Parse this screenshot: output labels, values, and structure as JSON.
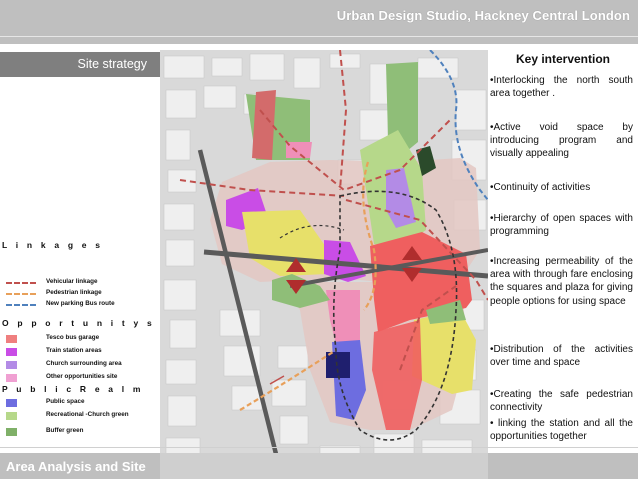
{
  "header": {
    "title": "Urban Design Studio, Hackney Central London"
  },
  "left": {
    "section_title": "Site strategy"
  },
  "legend": {
    "linkages_head": "L i n k a g e s",
    "linkages": [
      {
        "label": "Vehicular linkage",
        "color": "#c0504d"
      },
      {
        "label": "Pedestrian linkage",
        "color": "#e8a05a"
      },
      {
        "label": "New parking Bus route",
        "color": "#4f81bd"
      }
    ],
    "opportunity_head": "O p p o r t u n i t y s i t e s",
    "opportunity": [
      {
        "label": "Tesco bus garage",
        "color": "#ef7f7f"
      },
      {
        "label": "Train station areas",
        "color": "#c94de6"
      },
      {
        "label": "Church surrounding area",
        "color": "#b38be6"
      },
      {
        "label": "Other opportunities site",
        "color": "#f0a0d2"
      }
    ],
    "public_head": "P u b l i c R e a l m",
    "public": [
      {
        "label": "Public space",
        "color": "#6d6de0"
      },
      {
        "label": "Recreational -Church green",
        "color": "#b6d88a"
      },
      {
        "label": "Buffer green",
        "color": "#7fb068"
      }
    ]
  },
  "key": {
    "title": "Key intervention",
    "bullets": [
      "•Interlocking the north south area together .",
      "•Active void space by introducing program and visually appealing",
      "•Continuity of activities",
      "•Hierarchy of open spaces with programming",
      "•Increasing permeability of the area with through fare enclosing the squares and plaza for giving people options for using space",
      "•Distribution of the activities over time and space",
      "•Creating the safe pedestrian connectivity",
      "• linking the station and all the opportunities together"
    ]
  },
  "footer": {
    "label": "Area Analysis and Site"
  }
}
